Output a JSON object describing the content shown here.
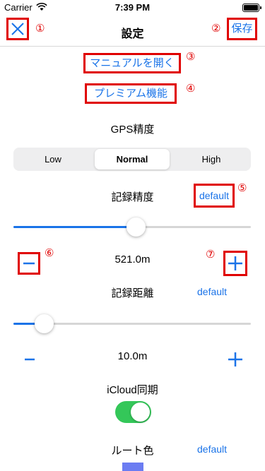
{
  "status_bar": {
    "carrier": "Carrier",
    "time": "7:39 PM"
  },
  "nav": {
    "title": "設定",
    "save_label": "保存"
  },
  "annotations": {
    "n1": "①",
    "n2": "②",
    "n3": "③",
    "n4": "④",
    "n5": "⑤",
    "n6": "⑥",
    "n7": "⑦"
  },
  "links": {
    "manual": "マニュアルを開く",
    "premium": "プレミアム機能"
  },
  "gps": {
    "label": "GPS精度",
    "options": [
      "Low",
      "Normal",
      "High"
    ],
    "selected": "Normal"
  },
  "record_accuracy": {
    "label": "記録精度",
    "default_label": "default",
    "value": "521.0m",
    "slider_fraction": 0.51
  },
  "record_distance": {
    "label": "記録距離",
    "default_label": "default",
    "value": "10.0m",
    "slider_fraction": 0.13
  },
  "icloud": {
    "label": "iCloud同期",
    "enabled": true
  },
  "route_color": {
    "label": "ルート色",
    "default_label": "default",
    "color": "#6b7cf2"
  },
  "colors": {
    "accent": "#1a73e8",
    "annotation": "#e00000",
    "toggle_on": "#34c759"
  }
}
